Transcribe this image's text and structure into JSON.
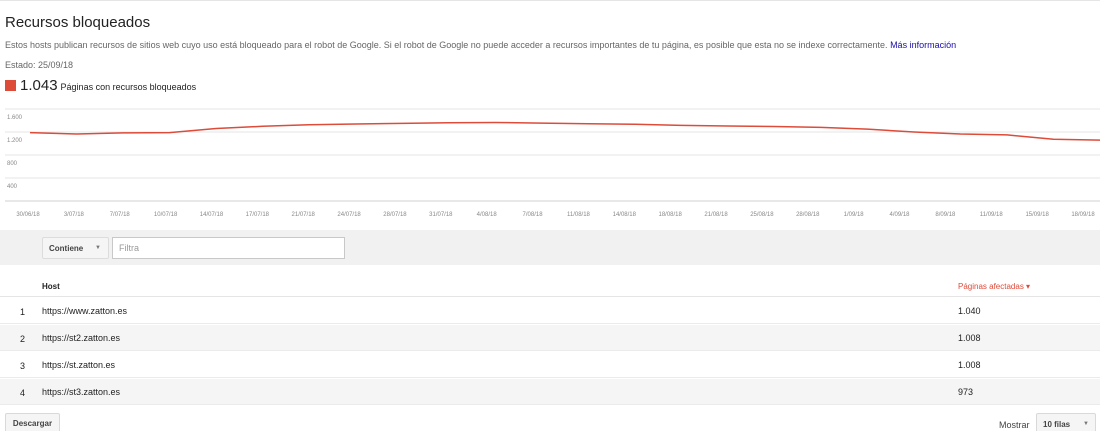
{
  "page": {
    "title": "Recursos bloqueados",
    "description": "Estos hosts publican recursos de sitios web cuyo uso está bloqueado para el robot de Google. Si el robot de Google no puede acceder a recursos importantes de tu página, es posible que esta no se indexe correctamente.",
    "more_info": "Más información",
    "estado": "Estado: 25/09/18"
  },
  "legend": {
    "value": "1.043",
    "label": "Páginas con recursos bloqueados",
    "color": "#dd4b39"
  },
  "chart_data": {
    "type": "line",
    "series": [
      {
        "name": "Páginas con recursos bloqueados",
        "color": "#dd4b39",
        "x": [
          "30/06/18",
          "3/07/18",
          "7/07/18",
          "10/07/18",
          "14/07/18",
          "17/07/18",
          "21/07/18",
          "24/07/18",
          "28/07/18",
          "31/07/18",
          "4/08/18",
          "7/08/18",
          "11/08/18",
          "14/08/18",
          "18/08/18",
          "21/08/18",
          "25/08/18",
          "28/08/18",
          "1/09/18",
          "4/09/18",
          "8/09/18",
          "11/09/18",
          "15/09/18",
          "18/09/18"
        ],
        "values": [
          1190,
          1165,
          1185,
          1190,
          1260,
          1300,
          1325,
          1340,
          1350,
          1360,
          1365,
          1355,
          1345,
          1335,
          1315,
          1305,
          1295,
          1280,
          1250,
          1200,
          1165,
          1150,
          1075,
          1060
        ]
      }
    ],
    "x_tick_labels": [
      "30/06/18",
      "3/07/18",
      "7/07/18",
      "10/07/18",
      "14/07/18",
      "17/07/18",
      "21/07/18",
      "24/07/18",
      "28/07/18",
      "31/07/18",
      "4/08/18",
      "7/08/18",
      "11/08/18",
      "14/08/18",
      "18/08/18",
      "21/08/18",
      "25/08/18",
      "28/08/18",
      "1/09/18",
      "4/09/18",
      "8/09/18",
      "11/09/18",
      "15/09/18",
      "18/09/18"
    ],
    "y_ticks": [
      {
        "value": 1600,
        "label": "1.600"
      },
      {
        "value": 1200,
        "label": "1.200"
      },
      {
        "value": 800,
        "label": "800"
      },
      {
        "value": 400,
        "label": "400"
      }
    ],
    "ylim": [
      0,
      1600
    ],
    "grid": true
  },
  "filter": {
    "operator": "Contiene",
    "placeholder": "Filtra",
    "value": ""
  },
  "table": {
    "headers": {
      "host": "Host",
      "pages": "Páginas afectadas ▾"
    },
    "rows": [
      {
        "index": "1",
        "host": "https://www.zatton.es",
        "pages": "1.040"
      },
      {
        "index": "2",
        "host": "https://st2.zatton.es",
        "pages": "1.008"
      },
      {
        "index": "3",
        "host": "https://st.zatton.es",
        "pages": "1.008"
      },
      {
        "index": "4",
        "host": "https://st3.zatton.es",
        "pages": "973"
      }
    ]
  },
  "footer": {
    "download": "Descargar",
    "show": "Mostrar",
    "rows_option": "10 filas"
  }
}
